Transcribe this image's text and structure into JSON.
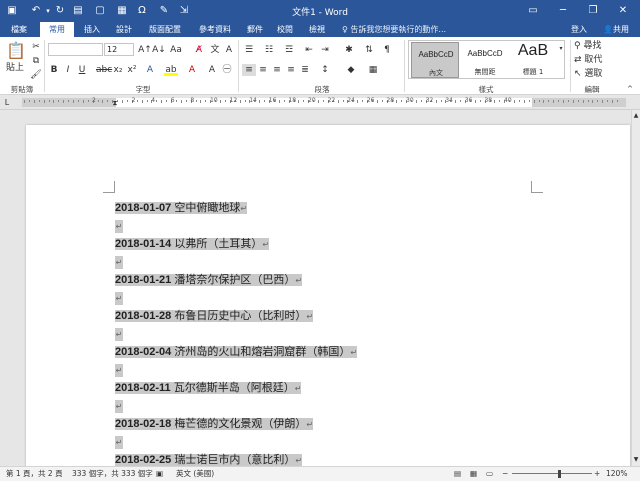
{
  "titlebar": {
    "title": "文件1 - Word",
    "quick_access": [
      "save-icon",
      "undo-icon",
      "redo-icon",
      "repeat-icon",
      "print-preview-icon",
      "omega-icon",
      "customize-icon"
    ],
    "window_controls": [
      "ribbon-display-icon",
      "minimize-icon",
      "restore-icon",
      "close-icon"
    ]
  },
  "tabs": [
    "檔案",
    "常用",
    "插入",
    "設計",
    "版面配置",
    "參考資料",
    "郵件",
    "校閱",
    "檢視"
  ],
  "active_tab": "常用",
  "tell_me": "告訴我您想要執行的動作...",
  "account": {
    "signin": "登入",
    "share": "共用"
  },
  "ribbon": {
    "clipboard": {
      "paste": "貼上",
      "label": "剪貼簿"
    },
    "font": {
      "name": "",
      "size": "12",
      "label": "字型"
    },
    "paragraph": {
      "label": "段落"
    },
    "styles": {
      "label": "樣式",
      "items": [
        {
          "preview": "AaBbCcD",
          "name": "內文"
        },
        {
          "preview": "AaBbCcD",
          "name": "無間距"
        },
        {
          "preview": "AaB",
          "name": "標題 1"
        }
      ]
    },
    "editing": {
      "find": "尋找",
      "replace": "取代",
      "select": "選取",
      "label": "編輯"
    }
  },
  "ruler": {
    "numbers": [
      "2",
      "2",
      "4",
      "6",
      "8",
      "10",
      "12",
      "14",
      "16",
      "18",
      "20",
      "22",
      "24",
      "26",
      "28",
      "30",
      "32",
      "34",
      "36",
      "38",
      "40"
    ]
  },
  "document": {
    "lines": [
      {
        "date": "2018-01-07",
        "text": "空中俯瞰地球"
      },
      {
        "date": "2018-01-14",
        "text": "以弗所（土耳其）"
      },
      {
        "date": "2018-01-21",
        "text": "潘塔奈尔保护区（巴西）"
      },
      {
        "date": "2018-01-28",
        "text": "布鲁日历史中心（比利时）"
      },
      {
        "date": "2018-02-04",
        "text": "济州岛的火山和熔岩洞窟群（韩国）"
      },
      {
        "date": "2018-02-11",
        "text": "瓦尔德斯半岛（阿根廷）"
      },
      {
        "date": "2018-02-18",
        "text": "梅芒德的文化景观（伊朗）"
      },
      {
        "date": "2018-02-25",
        "text": "瑞士诺巨市内（意比利）"
      }
    ],
    "para_mark": "↵"
  },
  "status": {
    "page": "第 1 頁，共 2 頁",
    "words": "333 個字，共 333 個字",
    "lang": "英文 (美國)",
    "zoom": "120%"
  }
}
